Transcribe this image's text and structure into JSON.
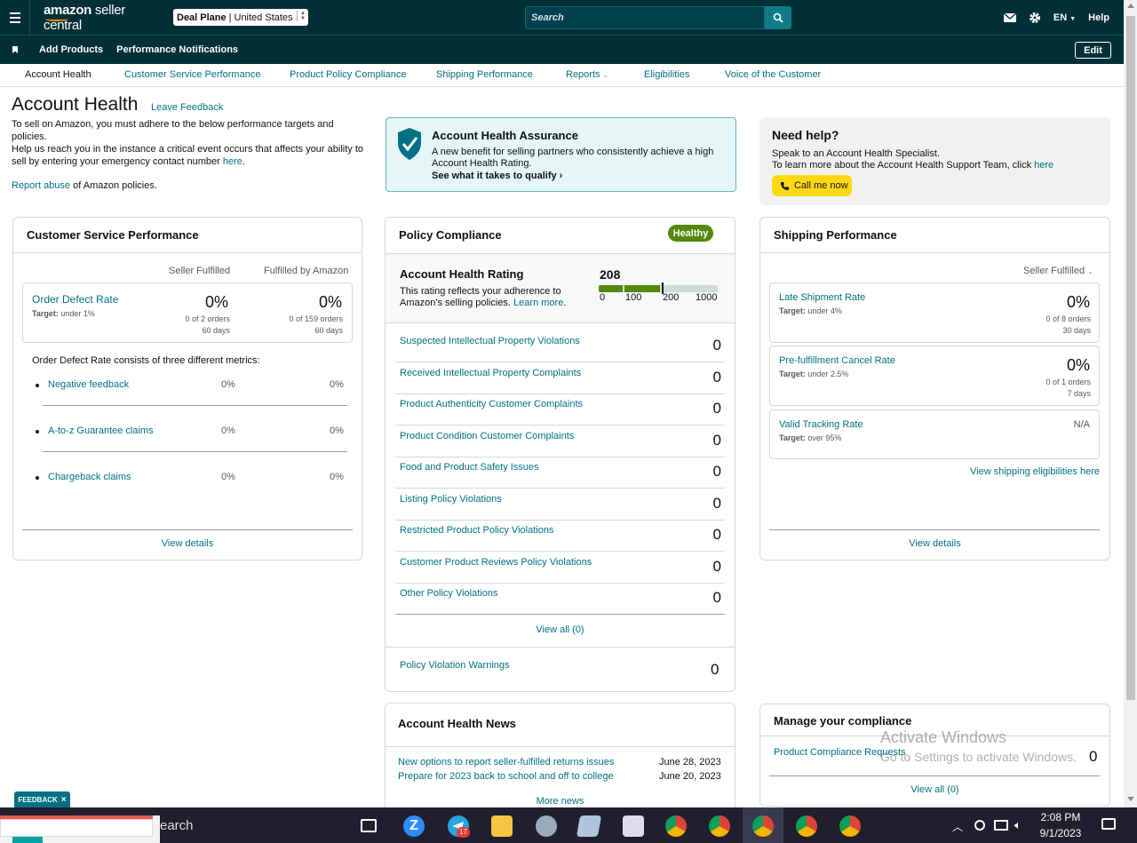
{
  "topbar": {
    "logo_part1": "amazon",
    "logo_part2": " seller central",
    "store_bold": "Deal Plane",
    "store_country": "United States",
    "search_placeholder": "Search",
    "language": "EN",
    "help": "Help"
  },
  "navbar2": {
    "add_products": "Add Products",
    "performance_notifications": "Performance Notifications",
    "edit": "Edit"
  },
  "tabs": [
    "Account Health",
    "Customer Service Performance",
    "Product Policy Compliance",
    "Shipping Performance",
    "Reports",
    "Eligibilities",
    "Voice of the Customer"
  ],
  "intro": {
    "title": "Account Health",
    "leave_feedback": "Leave Feedback",
    "line1": "To sell on Amazon, you must adhere to the below performance targets and policies.",
    "line2": "Help us reach you in the instance a critical event occurs that affects your ability to sell by entering your emergency contact number",
    "here": "here",
    "period": ".",
    "report_abuse": "Report abuse",
    "report_rest": " of Amazon policies."
  },
  "assurance": {
    "title": "Account Health Assurance",
    "body": "A new benefit for selling partners who consistently achieve a high Account Health Rating.",
    "cta": "See what it takes to qualify"
  },
  "help": {
    "title": "Need help?",
    "line1": "Speak to an Account Health Specialist.",
    "line2": "To learn more about the Account Health Support Team, click",
    "here": "here",
    "call": "Call me now"
  },
  "csp": {
    "title": "Customer Service Performance",
    "col1": "Seller Fulfilled",
    "col2": "Fulfilled by Amazon",
    "odr_label": "Order Defect Rate",
    "odr_target_label": "Target:",
    "odr_target": " under 1%",
    "sf_pct": "0%",
    "sf_orders": "0 of 2 orders",
    "sf_days": "60 days",
    "fba_pct": "0%",
    "fba_orders": "0 of 159 orders",
    "fba_days": "60 days",
    "metrics_intro": "Order Defect Rate consists of three different metrics:",
    "metrics": [
      {
        "label": "Negative feedback",
        "sf": "0%",
        "fba": "0%"
      },
      {
        "label": "A-to-z Guarantee claims",
        "sf": "0%",
        "fba": "0%"
      },
      {
        "label": "Chargeback claims",
        "sf": "0%",
        "fba": "0%"
      }
    ],
    "view_details": "View details"
  },
  "policy": {
    "title": "Policy Compliance",
    "badge": "Healthy",
    "ahr_title": "Account Health Rating",
    "ahr_value": "208",
    "ahr_desc1": "This rating reflects your adherence to",
    "ahr_desc2": "Amazon's selling policies.",
    "learn_more": "Learn more",
    "period": ".",
    "scale": [
      "0",
      "100",
      "200",
      "1000"
    ],
    "rating_fraction": 0.208,
    "rows": [
      {
        "label": "Suspected Intellectual Property Violations",
        "value": "0"
      },
      {
        "label": "Received Intellectual Property Complaints",
        "value": "0"
      },
      {
        "label": "Product Authenticity Customer Complaints",
        "value": "0"
      },
      {
        "label": "Product Condition Customer Complaints",
        "value": "0"
      },
      {
        "label": "Food and Product Safety Issues",
        "value": "0"
      },
      {
        "label": "Listing Policy Violations",
        "value": "0"
      },
      {
        "label": "Restricted Product Policy Violations",
        "value": "0"
      },
      {
        "label": "Customer Product Reviews Policy Violations",
        "value": "0"
      },
      {
        "label": "Other Policy Violations",
        "value": "0"
      }
    ],
    "view_all": "View all (0)",
    "warnings_label": "Policy Violation Warnings",
    "warnings_value": "0"
  },
  "shipping": {
    "title": "Shipping Performance",
    "filter": "Seller Fulfilled",
    "metrics": [
      {
        "label": "Late Shipment Rate",
        "target": " under 4%",
        "pct": "0%",
        "orders": "0 of 8 orders",
        "days": "30 days"
      },
      {
        "label": "Pre-fulfillment Cancel Rate",
        "target": " under 2.5%",
        "pct": "0%",
        "orders": "0 of 1 orders",
        "days": "7 days"
      },
      {
        "label": "Valid Tracking Rate",
        "target": " over 95%",
        "pct": "N/A",
        "orders": "",
        "days": ""
      }
    ],
    "target_label": "Target:",
    "eligibilities_link": "View shipping eligibilities here",
    "view_details": "View details"
  },
  "news": {
    "title": "Account Health News",
    "items": [
      {
        "label": "New options to report seller-fulfilled returns issues",
        "date": "June 28, 2023"
      },
      {
        "label": "Prepare for 2023 back to school and off to college",
        "date": "June 20, 2023"
      }
    ],
    "more": "More news"
  },
  "compliance": {
    "title": "Manage your compliance",
    "requests_label": "Product Compliance Requests",
    "requests_value": "0",
    "view_all": "View all (0)"
  },
  "feedback": "FEEDBACK",
  "watermark": {
    "line1": "Activate Windows",
    "line2": "Go to Settings to activate Windows."
  },
  "taskbar": {
    "search_text": "earch",
    "time": "2:08 PM",
    "date": "9/1/2023",
    "telegram_badge": "17"
  },
  "colors": {
    "header_bg": "#002f36",
    "link": "#007185",
    "healthy_green": "#548a0c",
    "call_yellow": "#ffd814"
  }
}
